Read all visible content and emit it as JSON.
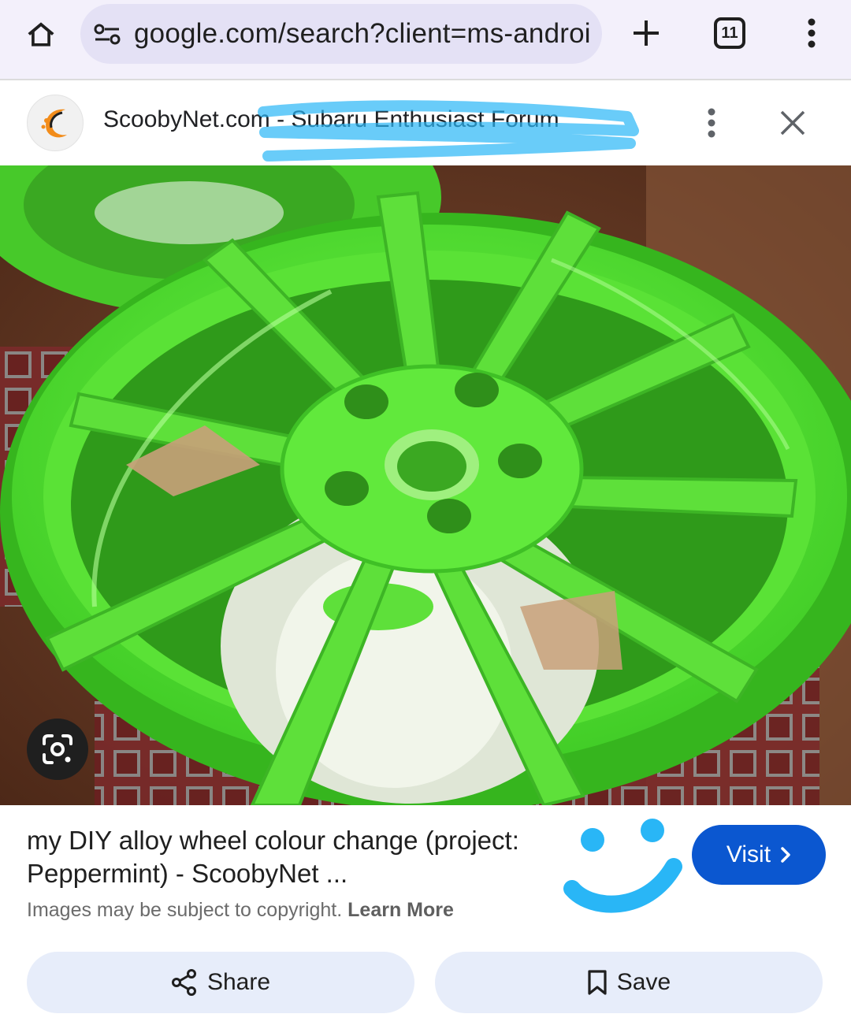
{
  "browser": {
    "url": "google.com/search?client=ms-androi",
    "tab_count": "11"
  },
  "source": {
    "title": "ScoobyNet.com - Subaru Enthusiast Forum"
  },
  "result": {
    "title": "my DIY alloy wheel colour change (project: Peppermint) - ScoobyNet ...",
    "copyright_text": "Images may be subject to copyright.",
    "learn_more": "Learn More",
    "visit_label": "Visit"
  },
  "actions": {
    "share_label": "Share",
    "save_label": "Save"
  },
  "icons": {
    "home": "home-icon",
    "site_settings": "tune-icon",
    "new_tab": "plus-icon",
    "tabs": "tab-switcher-icon",
    "menu": "more-vert-icon",
    "source_menu": "more-vert-icon",
    "close": "close-icon",
    "lens": "lens-icon",
    "visit": "chevron-right-icon",
    "share": "share-icon",
    "save": "bookmark-icon"
  },
  "colors": {
    "accent": "#0b57d0",
    "wheel": "#5ee03a",
    "scribble": "#29b6f6",
    "topbar": "#f3f0fb",
    "button_bg": "#e7edfa"
  }
}
